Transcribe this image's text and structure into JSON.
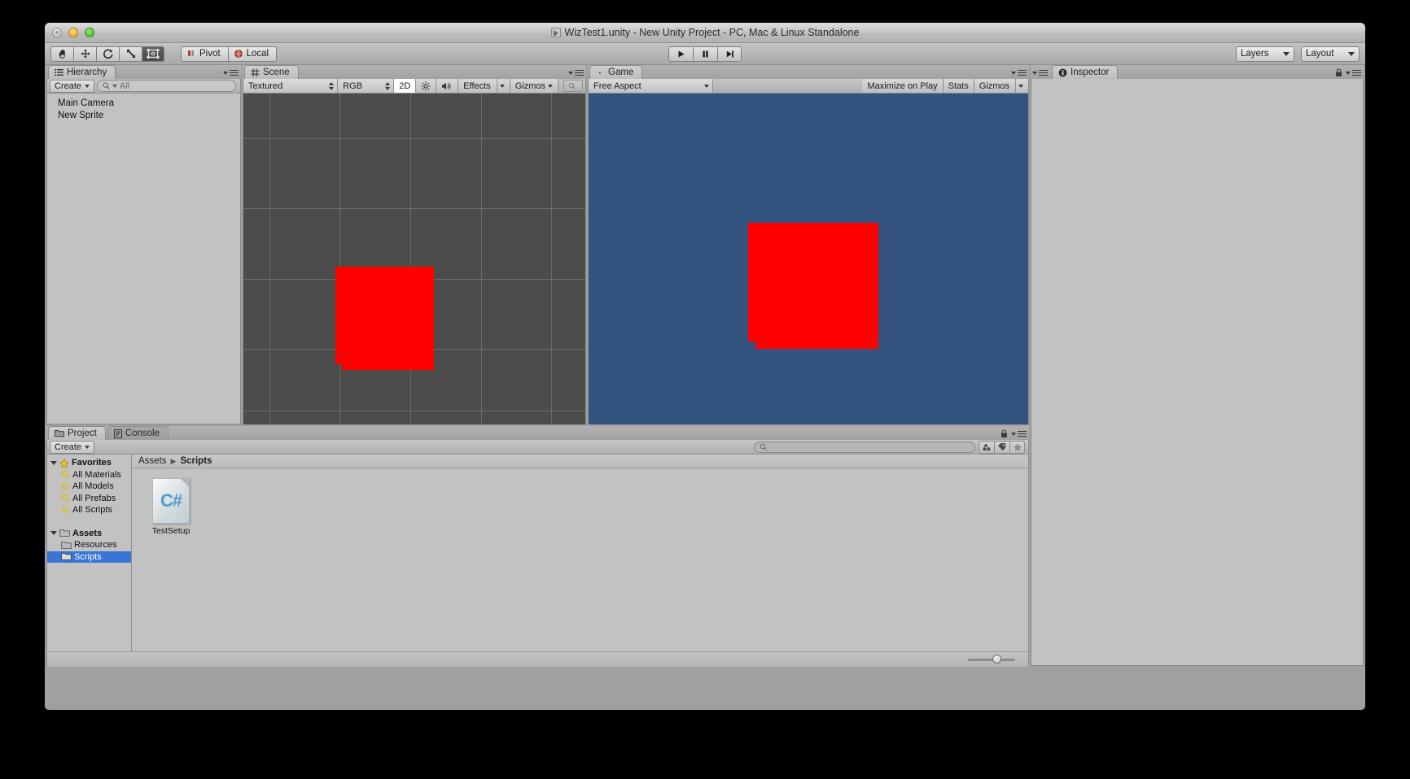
{
  "window": {
    "title": "WizTest1.unity - New Unity Project - PC, Mac & Linux Standalone",
    "app_icon": "unity-icon",
    "traffic_lights": [
      "close",
      "minimize",
      "zoom"
    ]
  },
  "toolbar": {
    "transform_tools": [
      {
        "name": "hand-tool",
        "label": "",
        "active": false
      },
      {
        "name": "move-tool",
        "label": "",
        "active": false
      },
      {
        "name": "rotate-tool",
        "label": "",
        "active": false
      },
      {
        "name": "scale-tool",
        "label": "",
        "active": false
      },
      {
        "name": "rect-tool",
        "label": "",
        "active": true
      }
    ],
    "pivot_label": "Pivot",
    "local_label": "Local",
    "play_label": "",
    "pause_label": "",
    "step_label": "",
    "layers_label": "Layers",
    "layout_label": "Layout"
  },
  "hierarchy": {
    "tab_label": "Hierarchy",
    "create_label": "Create",
    "search_placeholder": "All",
    "items": [
      {
        "label": "Main Camera"
      },
      {
        "label": "New Sprite"
      }
    ]
  },
  "scene": {
    "tab_label": "Scene",
    "draw_mode": "Textured",
    "color_mode": "RGB",
    "mode_2d": "2D",
    "lighting_icon": "sun-icon",
    "audio_icon": "speaker-icon",
    "effects_label": "Effects",
    "gizmos_label": "Gizmos",
    "sprite_color": "#ff0000"
  },
  "game": {
    "tab_label": "Game",
    "aspect_label": "Free Aspect",
    "maximize_label": "Maximize on Play",
    "stats_label": "Stats",
    "gizmos_label": "Gizmos",
    "background_color": "#35537f",
    "sprite_color": "#ff0000"
  },
  "inspector": {
    "tab_label": "Inspector",
    "empty": ""
  },
  "project": {
    "tab_label": "Project",
    "console_tab_label": "Console",
    "create_label": "Create",
    "search_placeholder": "",
    "filter_buttons": [
      "type-filter-icon",
      "label-filter-icon",
      "favorite-filter-icon"
    ],
    "breadcrumb": [
      "Assets",
      "Scripts"
    ],
    "tree": [
      {
        "label": "Favorites",
        "depth": 0,
        "icon": "star-icon",
        "expanded": true,
        "bold": true,
        "selected": false
      },
      {
        "label": "All Materials",
        "depth": 1,
        "icon": "search-icon",
        "bold": false,
        "selected": false
      },
      {
        "label": "All Models",
        "depth": 1,
        "icon": "search-icon",
        "bold": false,
        "selected": false
      },
      {
        "label": "All Prefabs",
        "depth": 1,
        "icon": "search-icon",
        "bold": false,
        "selected": false
      },
      {
        "label": "All Scripts",
        "depth": 1,
        "icon": "search-icon",
        "bold": false,
        "selected": false
      },
      {
        "label": "",
        "depth": 0,
        "icon": "",
        "bold": false,
        "selected": false
      },
      {
        "label": "Assets",
        "depth": 0,
        "icon": "folder-icon",
        "expanded": true,
        "bold": true,
        "selected": false
      },
      {
        "label": "Resources",
        "depth": 1,
        "icon": "folder-icon",
        "bold": false,
        "selected": false
      },
      {
        "label": "Scripts",
        "depth": 1,
        "icon": "folder-icon",
        "bold": false,
        "selected": true
      }
    ],
    "assets": [
      {
        "label": "TestSetup",
        "icon": "csharp-script-icon"
      }
    ],
    "zoom_value": 52
  }
}
